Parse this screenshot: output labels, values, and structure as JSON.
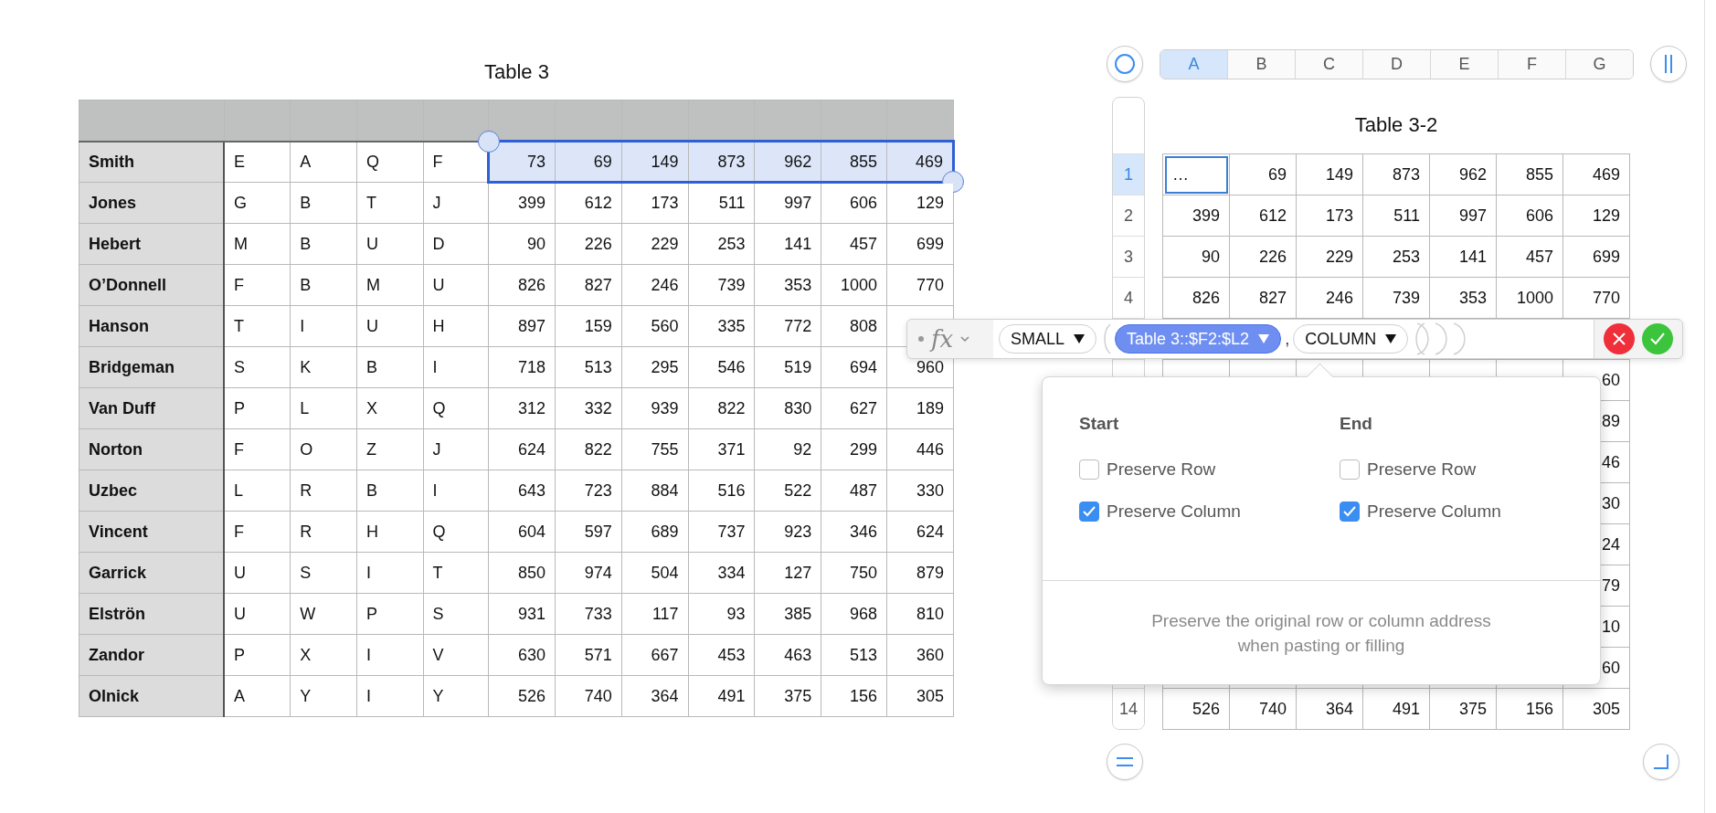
{
  "left_table": {
    "title": "Table 3",
    "rows": [
      {
        "name": "Smith",
        "letters": [
          "E",
          "A",
          "Q",
          "F"
        ],
        "numbers": [
          "73",
          "69",
          "149",
          "873",
          "962",
          "855",
          "469"
        ],
        "selected": true
      },
      {
        "name": "Jones",
        "letters": [
          "G",
          "B",
          "T",
          "J"
        ],
        "numbers": [
          "399",
          "612",
          "173",
          "511",
          "997",
          "606",
          "129"
        ],
        "selected": false
      },
      {
        "name": "Hebert",
        "letters": [
          "M",
          "B",
          "U",
          "D"
        ],
        "numbers": [
          "90",
          "226",
          "229",
          "253",
          "141",
          "457",
          "699"
        ],
        "selected": false
      },
      {
        "name": "O’Donnell",
        "letters": [
          "F",
          "B",
          "M",
          "U"
        ],
        "numbers": [
          "826",
          "827",
          "246",
          "739",
          "353",
          "1000",
          "770"
        ],
        "selected": false
      },
      {
        "name": "Hanson",
        "letters": [
          "T",
          "I",
          "U",
          "H"
        ],
        "numbers": [
          "897",
          "159",
          "560",
          "335",
          "772",
          "808"
        ],
        "selected": false
      },
      {
        "name": "Bridgeman",
        "letters": [
          "S",
          "K",
          "B",
          "I"
        ],
        "numbers": [
          "718",
          "513",
          "295",
          "546",
          "519",
          "694",
          "960"
        ],
        "selected": false
      },
      {
        "name": "Van Duff",
        "letters": [
          "P",
          "L",
          "X",
          "Q"
        ],
        "numbers": [
          "312",
          "332",
          "939",
          "822",
          "830",
          "627",
          "189"
        ],
        "selected": false
      },
      {
        "name": "Norton",
        "letters": [
          "F",
          "O",
          "Z",
          "J"
        ],
        "numbers": [
          "624",
          "822",
          "755",
          "371",
          "92",
          "299",
          "446"
        ],
        "selected": false
      },
      {
        "name": "Uzbec",
        "letters": [
          "L",
          "R",
          "B",
          "I"
        ],
        "numbers": [
          "643",
          "723",
          "884",
          "516",
          "522",
          "487",
          "330"
        ],
        "selected": false
      },
      {
        "name": "Vincent",
        "letters": [
          "F",
          "R",
          "H",
          "Q"
        ],
        "numbers": [
          "604",
          "597",
          "689",
          "737",
          "923",
          "346",
          "624"
        ],
        "selected": false
      },
      {
        "name": "Garrick",
        "letters": [
          "U",
          "S",
          "I",
          "T"
        ],
        "numbers": [
          "850",
          "974",
          "504",
          "334",
          "127",
          "750",
          "879"
        ],
        "selected": false
      },
      {
        "name": "Elströn",
        "letters": [
          "U",
          "W",
          "P",
          "S"
        ],
        "numbers": [
          "931",
          "733",
          "117",
          "93",
          "385",
          "968",
          "810"
        ],
        "selected": false
      },
      {
        "name": "Zandor",
        "letters": [
          "P",
          "X",
          "I",
          "V"
        ],
        "numbers": [
          "630",
          "571",
          "667",
          "453",
          "463",
          "513",
          "360"
        ],
        "selected": false
      },
      {
        "name": "Olnick",
        "letters": [
          "A",
          "Y",
          "I",
          "Y"
        ],
        "numbers": [
          "526",
          "740",
          "364",
          "491",
          "375",
          "156",
          "305"
        ],
        "selected": false
      }
    ]
  },
  "right_table": {
    "title": "Table 3-2",
    "columns": [
      {
        "label": "A",
        "selected": true
      },
      {
        "label": "B",
        "selected": false
      },
      {
        "label": "C",
        "selected": false
      },
      {
        "label": "D",
        "selected": false
      },
      {
        "label": "E",
        "selected": false
      },
      {
        "label": "F",
        "selected": false
      },
      {
        "label": "G",
        "selected": false
      }
    ],
    "rows": [
      {
        "number": "1",
        "selected": true,
        "cells": [
          "…",
          "69",
          "149",
          "873",
          "962",
          "855",
          "469"
        ]
      },
      {
        "number": "2",
        "selected": false,
        "cells": [
          "399",
          "612",
          "173",
          "511",
          "997",
          "606",
          "129"
        ]
      },
      {
        "number": "3",
        "selected": false,
        "cells": [
          "90",
          "226",
          "229",
          "253",
          "141",
          "457",
          "699"
        ]
      },
      {
        "number": "4",
        "selected": false,
        "cells": [
          "826",
          "827",
          "246",
          "739",
          "353",
          "1000",
          "770"
        ]
      }
    ],
    "covered_rows_last_column": [
      "60",
      "89",
      "46",
      "30",
      "24",
      "79",
      "10",
      "60"
    ],
    "last_row": {
      "number": "14",
      "selected": false,
      "cells": [
        "526",
        "740",
        "364",
        "491",
        "375",
        "156",
        "305"
      ]
    }
  },
  "formula_bar": {
    "fx": "fx",
    "tokens": [
      {
        "text": "SMALL",
        "selected": false
      },
      {
        "text": "Table 3::$F2:$L2",
        "selected": true
      },
      {
        "text": "COLUMN",
        "selected": false
      }
    ],
    "separator": ","
  },
  "popover": {
    "groups": [
      {
        "heading": "Start",
        "options": [
          {
            "label": "Preserve Row",
            "checked": false
          },
          {
            "label": "Preserve Column",
            "checked": true
          }
        ]
      },
      {
        "heading": "End",
        "options": [
          {
            "label": "Preserve Row",
            "checked": false
          },
          {
            "label": "Preserve Column",
            "checked": true
          }
        ]
      }
    ],
    "help": "Preserve the original row or column address when pasting or filling"
  }
}
